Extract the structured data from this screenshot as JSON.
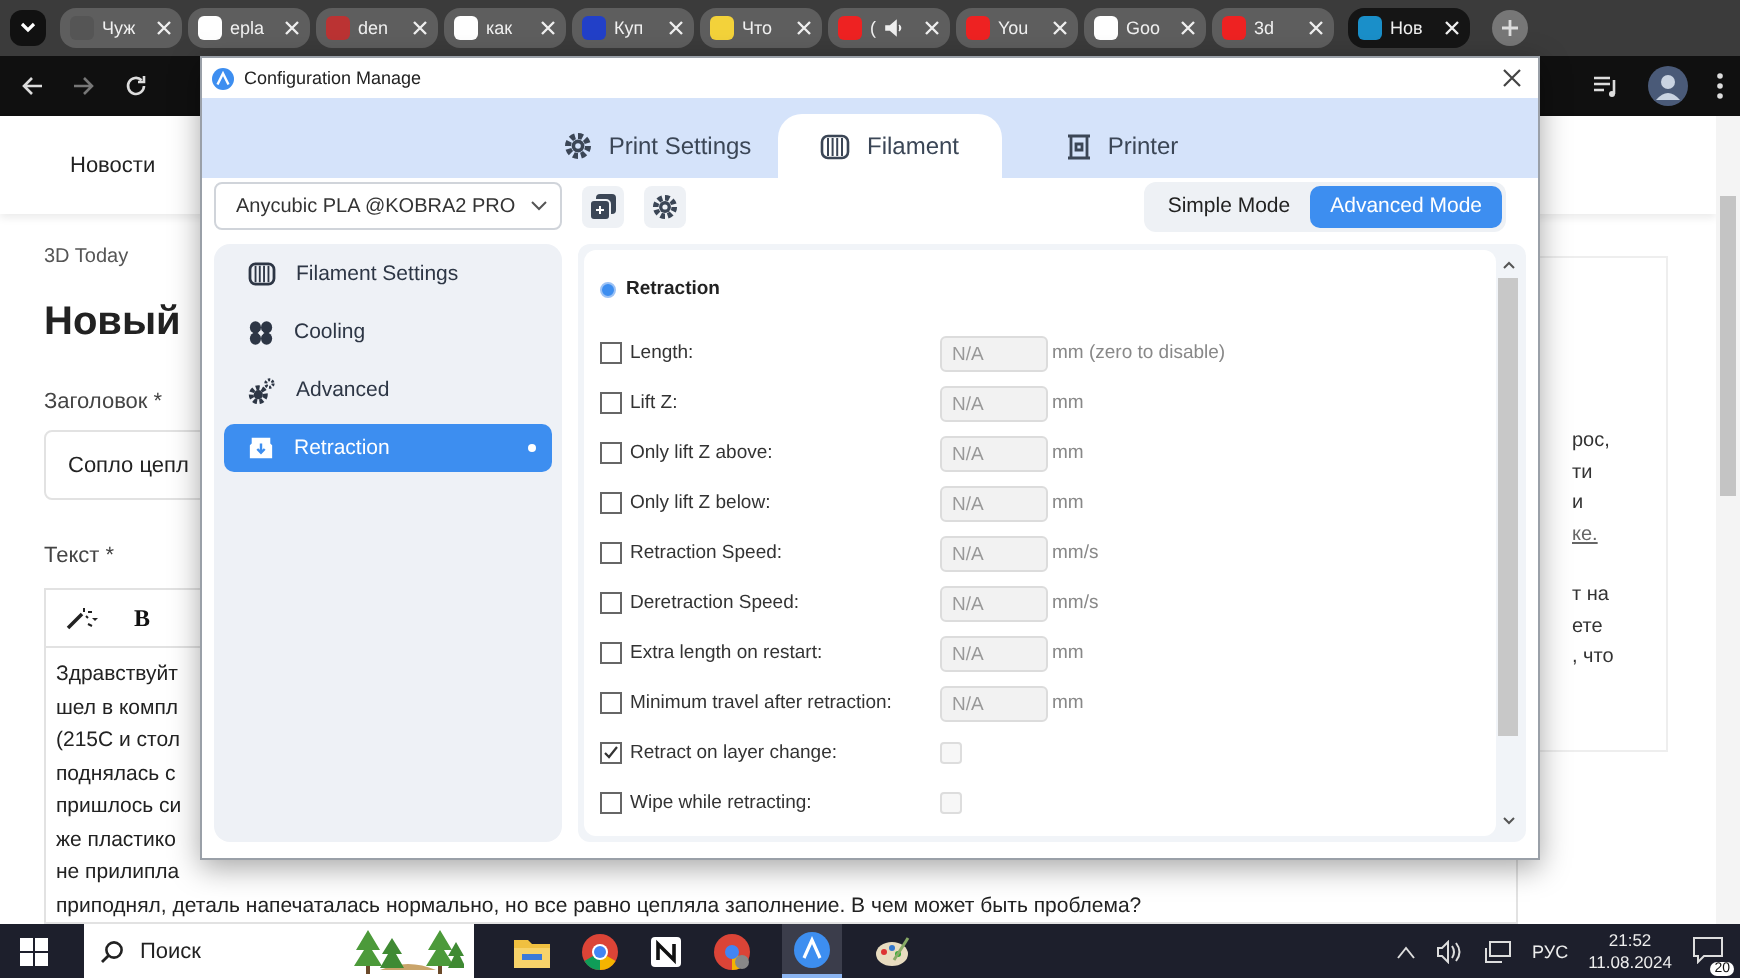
{
  "browser": {
    "tabs": [
      {
        "title": "Чуж",
        "audio": false,
        "selected": false
      },
      {
        "title": "epla",
        "audio": false,
        "selected": false
      },
      {
        "title": "den",
        "audio": false,
        "selected": false
      },
      {
        "title": "как",
        "audio": false,
        "selected": false
      },
      {
        "title": "Куп",
        "audio": false,
        "selected": false
      },
      {
        "title": "Что",
        "audio": false,
        "selected": false
      },
      {
        "title": "(",
        "audio": true,
        "selected": false
      },
      {
        "title": "You",
        "audio": false,
        "selected": false
      },
      {
        "title": "Goo",
        "audio": false,
        "selected": false
      },
      {
        "title": "3d",
        "audio": false,
        "selected": false
      },
      {
        "title": "Нов",
        "audio": false,
        "selected": true
      }
    ]
  },
  "page": {
    "nav": "Новости",
    "breadcrumb": "3D Today",
    "heading": "Новый",
    "title_label": "Заголовок *",
    "title_value": "Сопло цепл",
    "text_label": "Текст *",
    "bold_button": "B",
    "body_lines": [
      "Здравствуйт",
      "шел в компл",
      "(215С и стол",
      "поднялась с",
      "пришлось си",
      "же пластико",
      "не прилипла"
    ],
    "last_line": "приподнял, деталь напечаталась нормально, но все равно цепляла заполнение. В чем может быть проблема?",
    "side_lines": [
      {
        "text": "рос,",
        "link": false
      },
      {
        "text": "ти",
        "link": false
      },
      {
        "text": "и",
        "link": false
      },
      {
        "text": "ке.",
        "link": true
      },
      {
        "text": "т на",
        "link": false
      },
      {
        "text": "ете",
        "link": false
      },
      {
        "text": ", что",
        "link": false
      }
    ]
  },
  "dialog": {
    "title": "Configuration Manage",
    "tabs": [
      {
        "label": "Print Settings",
        "selected": false
      },
      {
        "label": "Filament",
        "selected": true
      },
      {
        "label": "Printer",
        "selected": false
      }
    ],
    "preset": "Anycubic PLA @KOBRA2 PRO",
    "modes": [
      {
        "label": "Simple Mode",
        "selected": false
      },
      {
        "label": "Advanced Mode",
        "selected": true
      }
    ],
    "sidebar": [
      {
        "label": "Filament Settings",
        "selected": false
      },
      {
        "label": "Cooling",
        "selected": false
      },
      {
        "label": "Advanced",
        "selected": false
      },
      {
        "label": "Retraction",
        "selected": true
      }
    ],
    "section": "Retraction",
    "settings": [
      {
        "kind": "number",
        "label": "Length:",
        "checked": false,
        "value": "N/A",
        "unit": "mm (zero to disable)"
      },
      {
        "kind": "number",
        "label": "Lift Z:",
        "checked": false,
        "value": "N/A",
        "unit": "mm"
      },
      {
        "kind": "number",
        "label": "Only lift Z above:",
        "checked": false,
        "value": "N/A",
        "unit": "mm"
      },
      {
        "kind": "number",
        "label": "Only lift Z below:",
        "checked": false,
        "value": "N/A",
        "unit": "mm"
      },
      {
        "kind": "number",
        "label": "Retraction Speed:",
        "checked": false,
        "value": "N/A",
        "unit": "mm/s"
      },
      {
        "kind": "number",
        "label": "Deretraction Speed:",
        "checked": false,
        "value": "N/A",
        "unit": "mm/s"
      },
      {
        "kind": "number",
        "label": "Extra length on restart:",
        "checked": false,
        "value": "N/A",
        "unit": "mm"
      },
      {
        "kind": "number",
        "label": "Minimum travel after retraction:",
        "checked": false,
        "value": "N/A",
        "unit": "mm"
      },
      {
        "kind": "toggle",
        "label": "Retract on layer change:",
        "checked": true,
        "value_checked": false
      },
      {
        "kind": "toggle",
        "label": "Wipe while retracting:",
        "checked": false,
        "value_checked": false
      }
    ]
  },
  "taskbar": {
    "search": "Поиск",
    "language": "РУС",
    "time": "21:52",
    "date": "11.08.2024",
    "notifications": "20"
  }
}
